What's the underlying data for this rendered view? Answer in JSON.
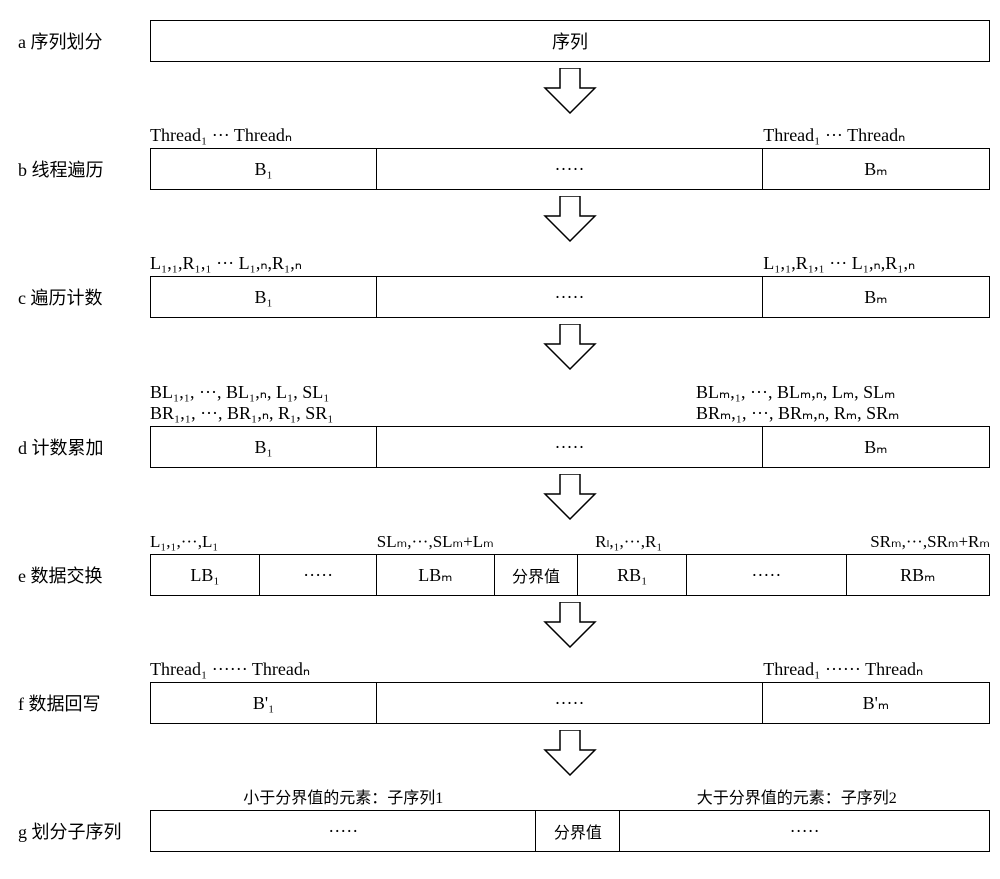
{
  "rows": {
    "a": {
      "label": "a 序列划分",
      "content": "序列"
    },
    "b": {
      "label": "b 线程遍历",
      "left_annot": "Thread₁  ···  Threadₙ",
      "right_annot": "Thread₁  ···  Threadₙ",
      "left_cell": "B₁",
      "mid_cell": "·····",
      "right_cell": "Bₘ"
    },
    "c": {
      "label": "c 遍历计数",
      "left_annot": "L₁,₁,R₁,₁ ···  L₁,ₙ,R₁,ₙ",
      "right_annot": "L₁,₁,R₁,₁ ···  L₁,ₙ,R₁,ₙ",
      "left_cell": "B₁",
      "mid_cell": "·····",
      "right_cell": "Bₘ"
    },
    "d": {
      "label": "d 计数累加",
      "left_annot_top": "BL₁,₁, ···, BL₁,ₙ, L₁, SL₁",
      "left_annot_bot": "BR₁,₁, ···, BR₁,ₙ, R₁, SR₁",
      "right_annot_top": "BLₘ,₁, ···, BLₘ,ₙ, Lₘ, SLₘ",
      "right_annot_bot": "BRₘ,₁, ···, BRₘ,ₙ, Rₘ, SRₘ",
      "left_cell": "B₁",
      "mid_cell": "·····",
      "right_cell": "Bₘ"
    },
    "e": {
      "label": "e 数据交换",
      "annot1": "L₁,₁,···,L₁",
      "annot2": "SLₘ,···,SLₘ+Lₘ",
      "annot3": "Rₗ,₁,···,R₁",
      "annot4": "SRₘ,···,SRₘ+Rₘ",
      "cells": [
        "LB₁",
        "·····",
        "LBₘ",
        "分界值",
        "RB₁",
        "·····",
        "RBₘ"
      ]
    },
    "f": {
      "label": "f 数据回写",
      "left_annot": "Thread₁ ······ Threadₙ",
      "right_annot": "Thread₁ ······ Threadₙ",
      "left_cell": "B'₁",
      "mid_cell": "·····",
      "right_cell": "B'ₘ"
    },
    "g": {
      "label": "g 划分子序列",
      "annot_left": "小于分界值的元素：子序列1",
      "annot_right": "大于分界值的元素：子序列2",
      "left_cell": "·····",
      "pivot": "分界值",
      "right_cell": "·····"
    }
  },
  "chart_data": {
    "type": "diagram",
    "title": "并行快速排序分区流程图",
    "steps": [
      {
        "id": "a",
        "name": "序列划分",
        "content": "序列"
      },
      {
        "id": "b",
        "name": "线程遍历",
        "blocks": [
          "B₁",
          "…",
          "Bₘ"
        ],
        "per_block_threads": [
          "Thread₁",
          "…",
          "Threadₙ"
        ]
      },
      {
        "id": "c",
        "name": "遍历计数",
        "blocks": [
          "B₁",
          "…",
          "Bₘ"
        ],
        "per_thread_counts": "L_{i,j}, R_{i,j}"
      },
      {
        "id": "d",
        "name": "计数累加",
        "blocks": [
          "B₁",
          "…",
          "Bₘ"
        ],
        "accumulated": [
          "BL_{i,j}",
          "L_i",
          "SL_i",
          "BR_{i,j}",
          "R_i",
          "SR_i"
        ]
      },
      {
        "id": "e",
        "name": "数据交换",
        "layout": [
          "LB₁",
          "…",
          "LBₘ",
          "分界值",
          "RB₁",
          "…",
          "RBₘ"
        ],
        "left_ranges": [
          "L₁,₁..L₁",
          "SLₘ..SLₘ+Lₘ"
        ],
        "right_ranges": [
          "Rₗ,₁..R₁",
          "SRₘ..SRₘ+Rₘ"
        ]
      },
      {
        "id": "f",
        "name": "数据回写",
        "blocks": [
          "B'₁",
          "…",
          "B'ₘ"
        ],
        "per_block_threads": [
          "Thread₁",
          "…",
          "Threadₙ"
        ]
      },
      {
        "id": "g",
        "name": "划分子序列",
        "left": "子序列1 (< 分界值)",
        "pivot": "分界值",
        "right": "子序列2 (> 分界值)"
      }
    ]
  }
}
